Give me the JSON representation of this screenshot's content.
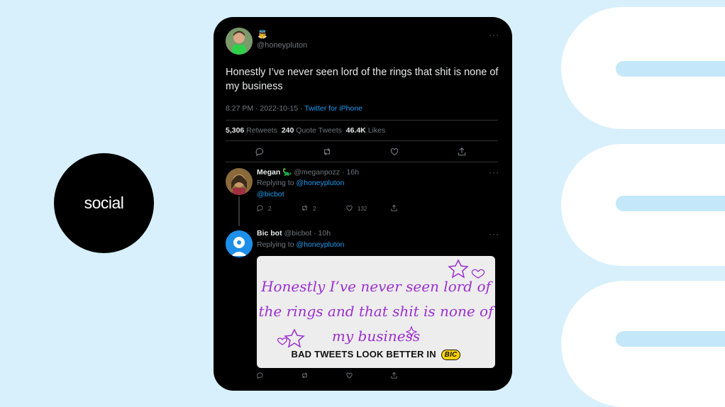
{
  "side_label": "social",
  "tweet": {
    "emoji": "👼",
    "handle": "@honeypluton",
    "text": "Honestly I’ve never seen lord of the rings that shit is none of my business",
    "time": "8:27 PM · 2022-10-15 · ",
    "source": "Twitter for iPhone",
    "stats": {
      "retweets_value": "5,306",
      "retweets_label": "Retweets",
      "quotes_value": "240",
      "quotes_label": "Quote Tweets",
      "likes_value": "46.4K",
      "likes_label": "Likes"
    },
    "more": "···"
  },
  "reply1": {
    "name": "Megan",
    "emoji": "🦕",
    "handle": "@meganpozz · 16h",
    "replying_prefix": "Replying to ",
    "replying_to": "@honeypluton",
    "text": "@bicbot",
    "reply_count": "2",
    "retweet_count": "2",
    "like_count": "132",
    "more": "···"
  },
  "reply2": {
    "name": "Bic bot",
    "handle": "@bicbot · 10h",
    "replying_prefix": "Replying to ",
    "replying_to": "@honeypluton",
    "more": "···",
    "image_text": "Honestly I’ve never seen lord of the rings and that shit is none of my business",
    "image_tagline": "BAD TWEETS LOOK BETTER IN",
    "image_logo": "BIC"
  },
  "colors": {
    "background": "#d7f0fc",
    "card": "#000000",
    "link": "#1d9bf0",
    "handwriting": "#9b2fd0"
  },
  "icons": [
    "reply-icon",
    "retweet-icon",
    "like-icon",
    "share-icon"
  ]
}
